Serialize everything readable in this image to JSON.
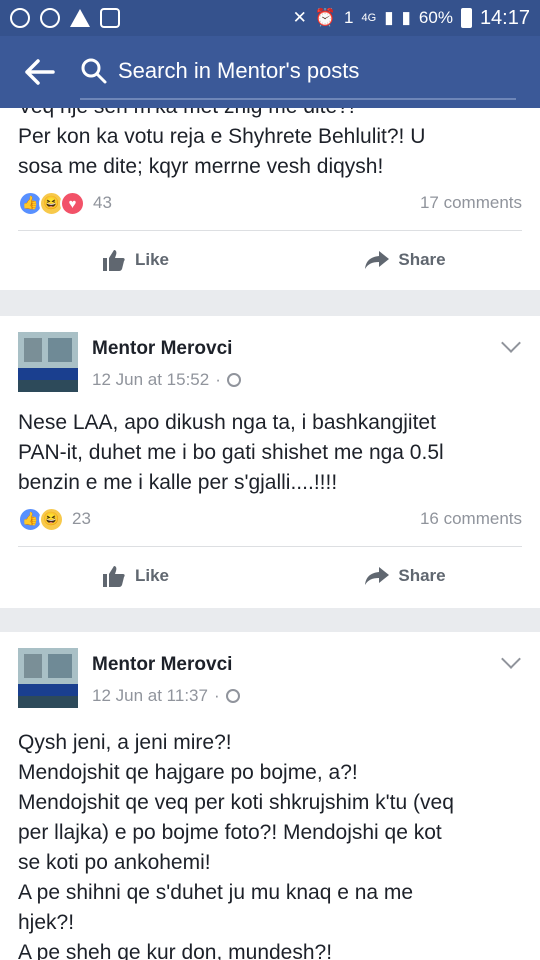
{
  "status_bar": {
    "battery": "60%",
    "time": "14:17",
    "network": "4G",
    "sim": "1"
  },
  "top_bar": {
    "search_placeholder": "Search in Mentor's posts"
  },
  "posts": [
    {
      "text_lines": [
        "Veq nje sen m'ka met zhig me dite?!",
        "Per kon ka votu reja e Shyhrete Behlulit?! U",
        "sosa me dite; kqyr merrne vesh diqysh!"
      ],
      "reaction_count": "43",
      "comments": "17 comments",
      "like_label": "Like",
      "share_label": "Share"
    },
    {
      "author": "Mentor Merovci",
      "time": "12 Jun at 15:52",
      "dot": "·",
      "text_lines": [
        "Nese LAA, apo dikush nga ta, i bashkangjitet",
        "PAN-it, duhet me i bo gati shishet me nga 0.5l",
        "benzin e me i kalle per s'gjalli....!!!!"
      ],
      "reaction_count": "23",
      "comments": "16 comments",
      "like_label": "Like",
      "share_label": "Share"
    },
    {
      "author": "Mentor Merovci",
      "time": "12 Jun at 11:37",
      "dot": "·",
      "text_lines": [
        "Qysh jeni, a jeni mire?!",
        "Mendojshit qe hajgare po bojme, a?!",
        "Mendojshit qe veq per koti shkrujshim k'tu (veq",
        "per llajka) e po bojme foto?! Mendojshi qe kot",
        "se koti po ankohemi!",
        "A pe shihni qe s'duhet ju mu knaq e na me",
        "hjek?!",
        "A pe sheh qe kur don, mundesh?!"
      ]
    }
  ]
}
